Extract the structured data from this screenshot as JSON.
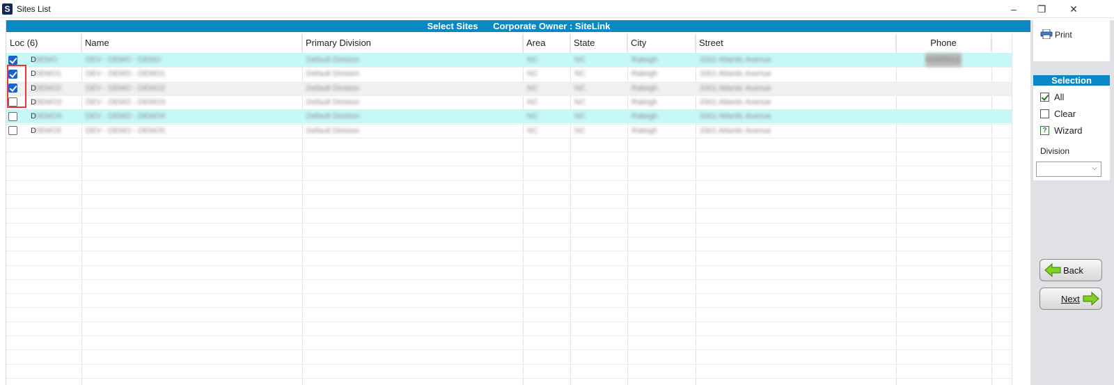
{
  "window": {
    "app_icon": "S",
    "title": "Sites List",
    "controls": {
      "minimize": "–",
      "restore": "❐",
      "close": "✕"
    }
  },
  "banner": {
    "text": "Select Sites      Corporate Owner : SiteLink"
  },
  "grid": {
    "columns": [
      {
        "key": "loc",
        "label": "Loc (6)"
      },
      {
        "key": "name",
        "label": "Name"
      },
      {
        "key": "division",
        "label": "Primary Division"
      },
      {
        "key": "area",
        "label": "Area"
      },
      {
        "key": "state",
        "label": "State"
      },
      {
        "key": "city",
        "label": "City"
      },
      {
        "key": "street",
        "label": "Street"
      },
      {
        "key": "phone",
        "label": "Phone"
      }
    ],
    "rows": [
      {
        "checked": true,
        "loc_prefix": "D",
        "loc": "DEMO",
        "name": "DEV - DEMO - DEMO",
        "division": "Default Division",
        "area": "NC",
        "state": "NC",
        "city": "Raleigh",
        "street": "3301 Atlantic Avenue",
        "phone": "9195551234"
      },
      {
        "checked": true,
        "loc_prefix": "D",
        "loc": "DEMO1",
        "name": "DEV - DEMO - DEMO1",
        "division": "Default Division",
        "area": "NC",
        "state": "NC",
        "city": "Raleigh",
        "street": "3301 Atlantic Avenue",
        "phone": ""
      },
      {
        "checked": true,
        "loc_prefix": "D",
        "loc": "DEMO2",
        "name": "DEV - DEMO - DEMO2",
        "division": "Default Division",
        "area": "NC",
        "state": "NC",
        "city": "Raleigh",
        "street": "3301 Atlantic Avenue",
        "phone": ""
      },
      {
        "checked": false,
        "loc_prefix": "D",
        "loc": "DEMO3",
        "name": "DEV - DEMO - DEMO3",
        "division": "Default Division",
        "area": "NC",
        "state": "NC",
        "city": "Raleigh",
        "street": "3301 Atlantic Avenue",
        "phone": ""
      },
      {
        "checked": false,
        "loc_prefix": "D",
        "loc": "DEMO4",
        "name": "DEV - DEMO - DEMO4",
        "division": "Default Division",
        "area": "NC",
        "state": "NC",
        "city": "Raleigh",
        "street": "3301 Atlantic Avenue",
        "phone": ""
      },
      {
        "checked": false,
        "loc_prefix": "D",
        "loc": "DEMO5",
        "name": "DEV - DEMO - DEMO5",
        "division": "Default Division",
        "area": "NC",
        "state": "NC",
        "city": "Raleigh",
        "street": "3301 Atlantic Avenue",
        "phone": ""
      }
    ]
  },
  "sidebar": {
    "print_label": "Print",
    "selection_title": "Selection",
    "options": [
      {
        "label": "All",
        "state": "checked"
      },
      {
        "label": "Clear",
        "state": "empty"
      },
      {
        "label": "Wizard",
        "state": "wizard",
        "glyph": "?"
      }
    ],
    "division_label": "Division",
    "division_value": "",
    "back_label": "Back",
    "next_label": "Next"
  },
  "colors": {
    "banner": "#0a88c6",
    "row_highlight": "#c6f8f8",
    "checkbox_checked": "#1b62c9",
    "annotation_box": "#e23a3a",
    "nav_arrow": "#7ed321"
  }
}
